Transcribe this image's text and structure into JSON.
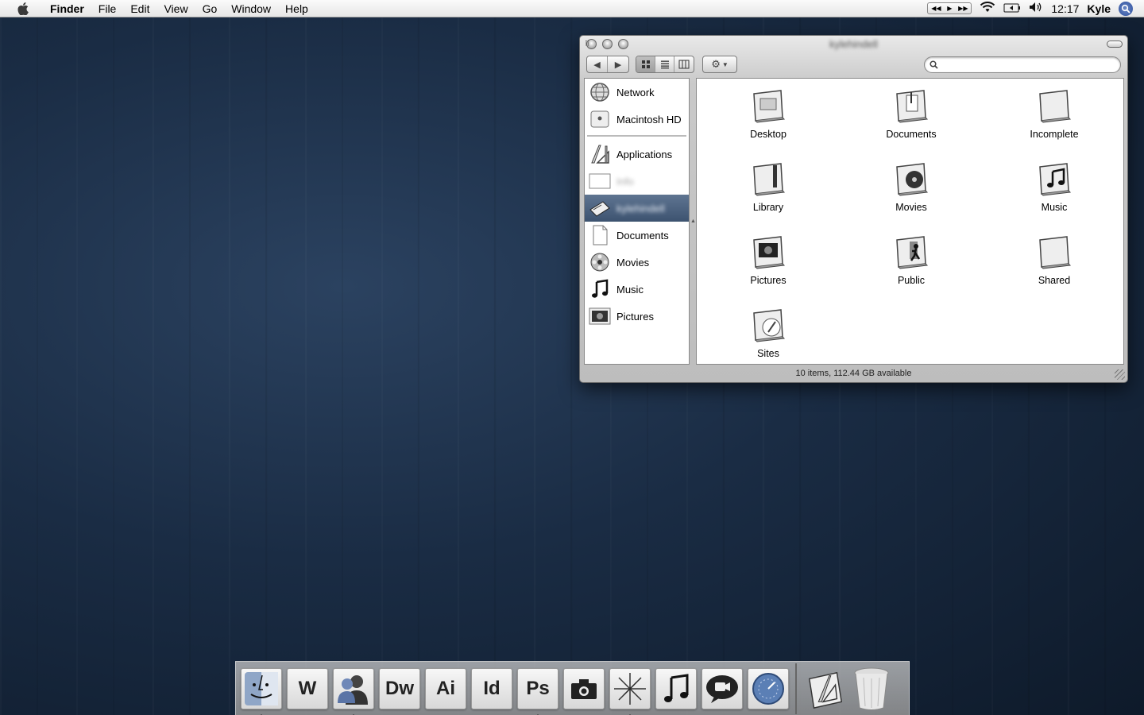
{
  "menubar": {
    "app": "Finder",
    "items": [
      "File",
      "Edit",
      "View",
      "Go",
      "Window",
      "Help"
    ],
    "time": "12:17",
    "user": "Kyle",
    "status_icons": [
      "media-controls-icon",
      "wifi-icon",
      "battery-icon",
      "volume-icon",
      "spotlight-icon"
    ]
  },
  "window": {
    "title": "kylehindell",
    "search": {
      "value": "",
      "placeholder": ""
    },
    "sidebar": [
      {
        "label": "Network",
        "icon": "globe-icon"
      },
      {
        "label": "Macintosh HD",
        "icon": "hard-drive-icon"
      },
      {
        "label": "Applications",
        "icon": "applications-icon"
      },
      {
        "label": "Info",
        "icon": "blank-document-icon"
      },
      {
        "label": "kylehindell",
        "icon": "home-icon"
      },
      {
        "label": "Documents",
        "icon": "documents-icon"
      },
      {
        "label": "Movies",
        "icon": "movies-icon"
      },
      {
        "label": "Music",
        "icon": "music-note-icon"
      },
      {
        "label": "Pictures",
        "icon": "pictures-icon"
      }
    ],
    "files": [
      {
        "name": "Desktop",
        "icon": "desktop-folder-icon"
      },
      {
        "name": "Documents",
        "icon": "documents-folder-icon"
      },
      {
        "name": "Incomplete",
        "icon": "folder-icon"
      },
      {
        "name": "Library",
        "icon": "library-folder-icon"
      },
      {
        "name": "Movies",
        "icon": "movies-folder-icon"
      },
      {
        "name": "Music",
        "icon": "music-folder-icon"
      },
      {
        "name": "Pictures",
        "icon": "pictures-folder-icon"
      },
      {
        "name": "Public",
        "icon": "public-folder-icon"
      },
      {
        "name": "Shared",
        "icon": "folder-icon"
      },
      {
        "name": "Sites",
        "icon": "sites-folder-icon"
      }
    ],
    "status": "10 items, 112.44 GB available"
  },
  "dock": {
    "apps": [
      {
        "label": "",
        "name": "finder-icon"
      },
      {
        "label": "W",
        "name": "word-icon"
      },
      {
        "label": "",
        "name": "ichat-buddy-icon"
      },
      {
        "label": "Dw",
        "name": "dreamweaver-icon"
      },
      {
        "label": "Ai",
        "name": "illustrator-icon"
      },
      {
        "label": "Id",
        "name": "indesign-icon"
      },
      {
        "label": "Ps",
        "name": "photoshop-icon"
      },
      {
        "label": "",
        "name": "camera-icon"
      },
      {
        "label": "",
        "name": "safari-compass-icon"
      },
      {
        "label": "",
        "name": "itunes-icon"
      },
      {
        "label": "",
        "name": "ichat-bubble-icon"
      },
      {
        "label": "",
        "name": "dashboard-icon"
      }
    ],
    "running": [
      "finder-icon",
      "ichat-buddy-icon",
      "photoshop-icon",
      "safari-compass-icon"
    ],
    "right": [
      "applications-stack-icon",
      "trash-icon"
    ]
  }
}
